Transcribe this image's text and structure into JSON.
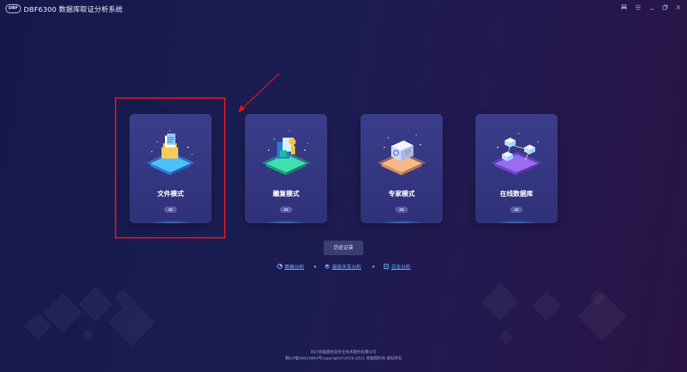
{
  "window": {
    "logo_text": "DBF",
    "title": "DBF6300 数据库取证分析系统",
    "controls": [
      "printer-icon",
      "menu-icon",
      "minimize-icon",
      "restore-icon",
      "close-icon"
    ]
  },
  "modes": [
    {
      "label": "文件模式",
      "icon": "file-folder-icon",
      "accent": "#3fa9f5",
      "selected": true
    },
    {
      "label": "雕复模式",
      "icon": "carving-recovery-icon",
      "accent": "#2fd3a0",
      "selected": false
    },
    {
      "label": "专家模式",
      "icon": "expert-server-icon",
      "accent": "#f0a96a",
      "selected": false
    },
    {
      "label": "在线数据库",
      "icon": "online-database-icon",
      "accent": "#9a6cf0",
      "selected": false
    }
  ],
  "history_button": "历史记录",
  "links": [
    {
      "label": "数据分析",
      "icon": "data-analysis-icon"
    },
    {
      "label": "层级关系分析",
      "icon": "layer-relationship-icon"
    },
    {
      "label": "日志分析",
      "icon": "log-analysis-icon"
    }
  ],
  "footer": {
    "line1": "四川效能圆信息安全技术股份有限公司",
    "line2": "蜀ICP备09015844号copyright©2019-2021 效能圆科技 版权所有"
  },
  "annotation": {
    "color": "#e0141c"
  }
}
